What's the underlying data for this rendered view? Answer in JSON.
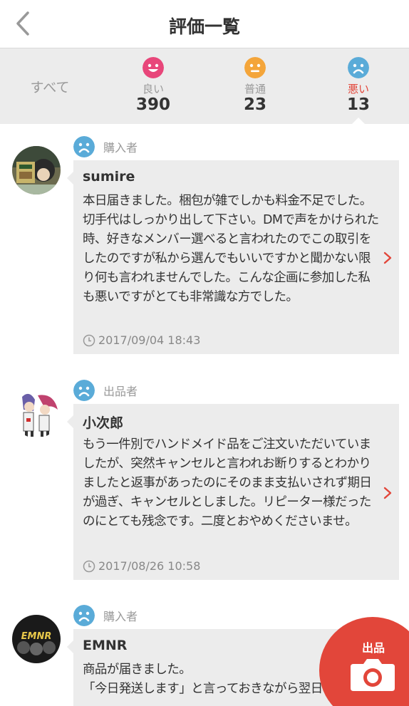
{
  "header": {
    "title": "評価一覧",
    "back_icon": "chevron-left-icon"
  },
  "tabs": {
    "all_label": "すべて",
    "items": [
      {
        "label": "良い",
        "count": "390",
        "face_color": "#e8467a",
        "face_icon": "happy-face-icon"
      },
      {
        "label": "普通",
        "count": "23",
        "face_color": "#f4a53a",
        "face_icon": "neutral-face-icon"
      },
      {
        "label": "悪い",
        "count": "13",
        "face_color": "#5aabd8",
        "face_icon": "sad-face-icon",
        "active": true
      }
    ]
  },
  "reviews": [
    {
      "role": "購入者",
      "name": "sumire",
      "comment": "本日届きました。梱包が雑でしかも料金不足でした。切手代はしっかり出して下さい。DMで声をかけられた時、好きなメンバー選べると言われたのでこの取引をしたのですが私から選んでもいいですかと聞かない限り何も言われませんでした。こんな企画に参加した私も悪いですがとても非常識な方でした。",
      "date": "2017/09/04 18:43"
    },
    {
      "role": "出品者",
      "name": "小次郎",
      "comment": "もう一件別でハンドメイド品をご注文いただいていましたが、突然キャンセルと言われお断りするとわかりましたと返事があったのにそのまま支払いされず期日が過ぎ、キャンセルとしました。リピーター様だったのにとても残念です。二度とおやめくださいませ。",
      "date": "2017/08/26 10:58"
    },
    {
      "role": "購入者",
      "name": "EMNR",
      "comment": "商品が届きました。\n「今日発送します」と言っておきながら翌日にな",
      "date": ""
    }
  ],
  "avatars": [
    "sumire-avatar",
    "character-avatar",
    "emnr-logo-avatar"
  ],
  "avatar_logo_text": "EMNR",
  "fab": {
    "label": "出品",
    "icon": "camera-icon"
  },
  "colors": {
    "accent": "#e2463a",
    "sad_face": "#5aabd8",
    "bubble_bg": "#ececec"
  }
}
